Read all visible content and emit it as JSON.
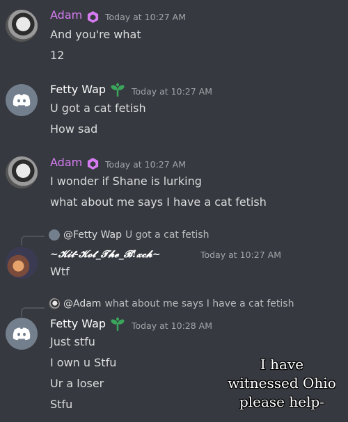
{
  "messages": [
    {
      "author": "Adam",
      "time": "Today at 10:27 AM",
      "lines": [
        "And you're what",
        "12"
      ]
    },
    {
      "author": "Fetty Wap",
      "time": "Today at 10:27 AM",
      "lines": [
        "U got a cat fetish",
        "How sad"
      ]
    },
    {
      "author": "Adam",
      "time": "Today at 10:27 AM",
      "lines": [
        "I wonder if Shane is lurking",
        "what about me says I have a cat fetish"
      ]
    },
    {
      "reply_to": "@Fetty Wap",
      "reply_text": "U got a cat fetish",
      "author": "~𝓚𝓲𝓽-𝓚𝓸𝓽_𝓣𝓱𝓮_𝓑!𝔁𝓬𝓱~",
      "time": "Today at 10:27 AM",
      "lines": [
        "Wtf"
      ]
    },
    {
      "reply_to": "@Adam",
      "reply_text": "what about me says I have a cat fetish",
      "author": "Fetty Wap",
      "time": "Today at 10:28 AM",
      "lines": [
        "Just stfu",
        "I own u Stfu",
        "Ur a loser",
        "Stfu"
      ]
    }
  ],
  "caption": {
    "line1": "I have",
    "line2": "witnessed Ohio",
    "line3": "please help-"
  },
  "colors": {
    "background": "#36393f",
    "nitro_purple": "#d67cf2",
    "sprout_green": "#3ba55c",
    "discord_avatar": "#747f8d"
  },
  "icons": {
    "boost": "hexagon-badge-icon",
    "sprout": "sprout-icon",
    "discord": "discord-logo-icon"
  }
}
